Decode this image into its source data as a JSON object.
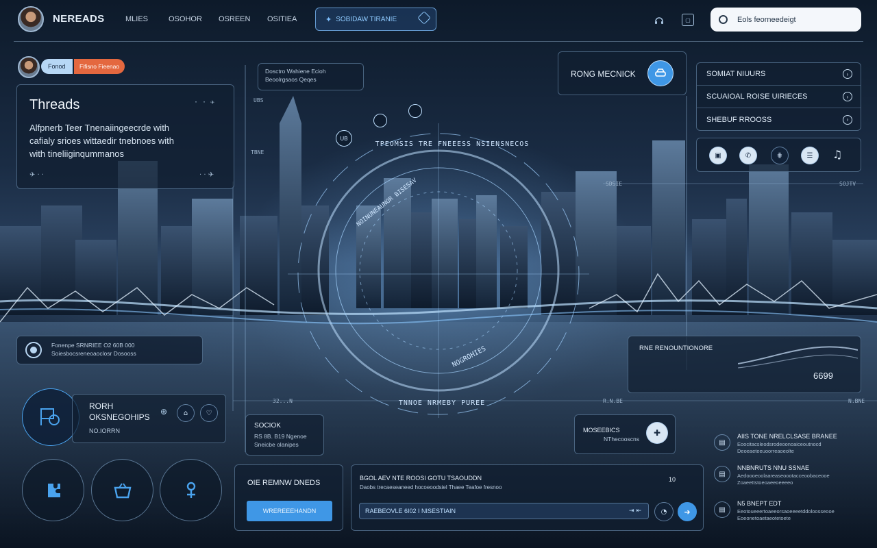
{
  "app": {
    "name": "NEREADS"
  },
  "nav": {
    "items": [
      "MLIES",
      "OSOHOR",
      "OSREEN",
      "OSITIEA"
    ]
  },
  "promo": {
    "label": "SOBIDAW TIRANIE"
  },
  "search": {
    "value": "Eols feorneedeigt"
  },
  "profile": {
    "tag": "Fonod",
    "status": "Fifisno Fieenao"
  },
  "threads_card": {
    "title": "Threads",
    "body": [
      "Alfpnerb Teer  Tnenaiingeecrde with",
      "cafialy srioes wittaedir  tnebnoes with",
      "with tineliiginqummanos"
    ]
  },
  "info_card": {
    "line1": "Dosctro  Wahiene Ecioh",
    "line2": "Beoolrgsaos  Qeqes"
  },
  "ring_card": {
    "label": "RONG MECNICK"
  },
  "menu": {
    "items": [
      {
        "label": "SOMIAT NIUURS"
      },
      {
        "label": "SCUAIOAL ROISE UIRIECES"
      },
      {
        "label": "SHEBUF RROOSS"
      }
    ]
  },
  "quick_icons": [
    "calendar-icon",
    "phone-icon",
    "grid-icon",
    "chat-icon",
    "music-icon"
  ],
  "hud": {
    "top_arc": "TPEOMSIS  TRE FNEEESS  NSIENSNECOS",
    "inner_arc": "NOINUNEAUNOR BISESAV",
    "bottom_arc": "TNNOE NRMEBY PUREE",
    "low_arc": "NOGROHIES",
    "badge1": "UB",
    "ticks": {
      "left_top": "UBS",
      "left_mid": "TBNE",
      "right_mid": "SDSIE",
      "right_far": "SOJTV",
      "left_low": "32...N",
      "right_low": "R.N.BE",
      "far_right_low": "N.BNE"
    }
  },
  "left_info": {
    "line1": "Fonenpe SRNRIEE O2 60B 000",
    "line2": "Soiesbocsreneoaoclosr Dosooss"
  },
  "right_info": {
    "label": "RNE RENOUNTIONORE",
    "value": "6699"
  },
  "route_card": {
    "title": "RORH",
    "subtitle": "OKSNEGOHIPS",
    "meta": "NO.IORRN"
  },
  "mid_card": {
    "title": "SOCIOK",
    "line1": "RS 8B. B19 Ngenoe",
    "line2": "Sneicbe olanipes"
  },
  "meta_card": {
    "title": "MOSEEBICS",
    "line": "NThecooscns"
  },
  "cta_card": {
    "title": "OIE REMNW DNEDS",
    "button": "WREREEEHANDN"
  },
  "compose": {
    "title": "BGOL AEV  NTE ROOSI  GOTU TSAOUDDN",
    "subtitle": "Daobs trecaeseaneed hocoeoodsiel Thaee Teafoe fresnoo",
    "count": "10",
    "input_value": "RAEBEOVLE 6I02  I NISESTIAIN"
  },
  "news": [
    {
      "title": "AIIS TONE NRELCLSASE BRANEE",
      "line1": "Eoocitacsleodsrodeoonoaiceoutnocd",
      "line2": "Deoeaeteeuoorreaoeolte"
    },
    {
      "title": "NNBNRUTS NNU SSNAE",
      "line1": "Aedoooeoolaareaseoootacceoobaceooe",
      "line2": "Zoaeettstoeoaeeoeeeeo"
    },
    {
      "title": "N5 BNEPT EDT",
      "line1": "Eeotoueeertoaeeorsaoeeeetddoloosseooe",
      "line2": "Eoeonetoaetaeotetoete"
    }
  ],
  "colors": {
    "accent": "#3f97e6",
    "badge_orange": "#e4683f",
    "panel_border": "#8cb4dc"
  }
}
